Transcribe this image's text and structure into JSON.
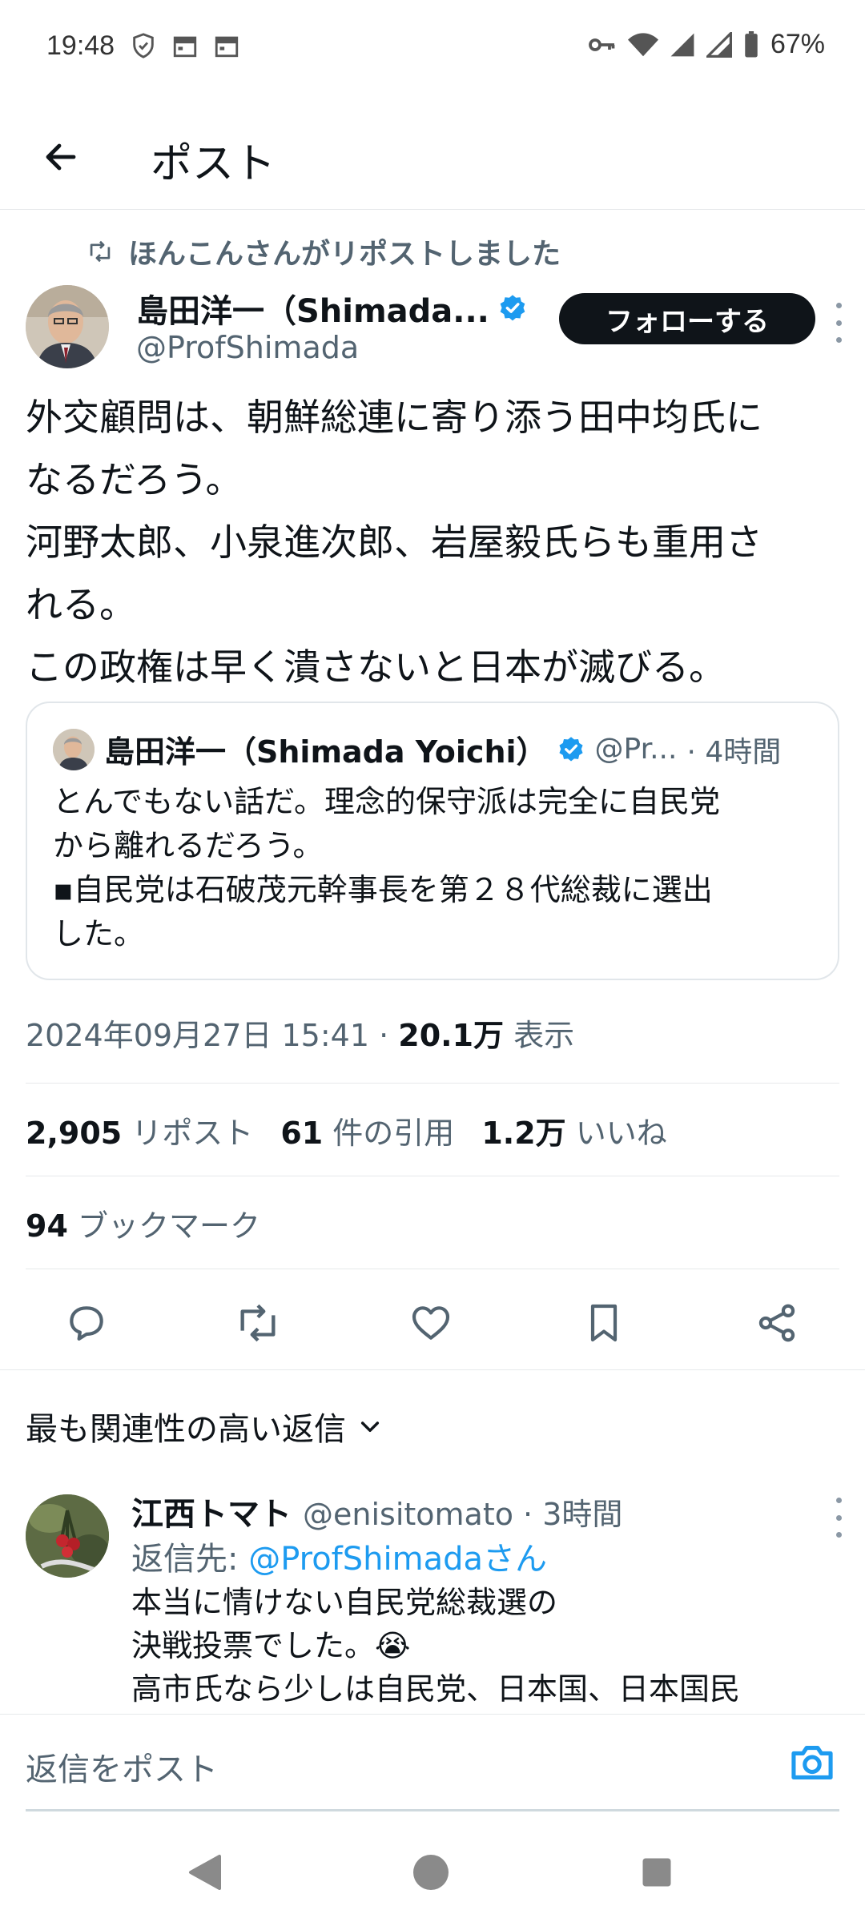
{
  "status_bar": {
    "time": "19:48",
    "battery": "67%",
    "icons_left": [
      "shield-icon",
      "calendar-icon",
      "calendar-icon"
    ],
    "icons_right": [
      "key-icon",
      "wifi-icon",
      "signal-icon",
      "signal-icon",
      "battery-icon"
    ]
  },
  "header": {
    "title": "ポスト",
    "back_icon": "arrow-left-icon"
  },
  "repost_notice": "ほんこんさんがリポストしました",
  "author": {
    "name": "島田洋一（Shimada...",
    "handle": "@ProfShimada",
    "verified": true,
    "follow_label": "フォローする"
  },
  "tweet": {
    "lines": [
      "外交顧問は、朝鮮総連に寄り添う田中均氏に",
      "なるだろう。",
      "河野太郎、小泉進次郎、岩屋毅氏らも重用さ",
      "れる。",
      "この政権は早く潰さないと日本が滅びる。"
    ]
  },
  "quote": {
    "name": "島田洋一（Shimada Yoichi）",
    "handle": "@Pr...",
    "time": "· 4時間",
    "lines": [
      "とんでもない話だ。理念的保守派は完全に自民党",
      "から離れるだろう。",
      "▪自民党は石破茂元幹事長を第２８代総裁に選出",
      "した。"
    ]
  },
  "meta": {
    "datetime": "2024年09月27日 15:41 · ",
    "views_value": "20.1万",
    "views_label": " 表示"
  },
  "stats": {
    "reposts_value": "2,905",
    "reposts_label": "リポスト",
    "quotes_value": "61",
    "quotes_label": "件の引用",
    "likes_value": "1.2万",
    "likes_label": "いいね",
    "bookmarks_value": "94",
    "bookmarks_label": "ブックマーク"
  },
  "actions": [
    "reply-icon",
    "repost-icon",
    "like-icon",
    "bookmark-icon",
    "share-icon"
  ],
  "sort": {
    "label": "最も関連性の高い返信"
  },
  "reply": {
    "name": "江西トマト",
    "handle": "@enisitomato · 3時間",
    "reply_to_prefix": "返信先: ",
    "reply_to_handle": "@ProfShimadaさん",
    "lines": [
      "本当に情けない自民党総裁選の",
      "決戦投票でした。😭",
      "高市氏なら少しは自民党、日本国、日本国民"
    ]
  },
  "compose": {
    "placeholder": "返信をポスト"
  },
  "colors": {
    "text": "#0f1419",
    "secondary": "#536471",
    "link": "#1d9bf0",
    "verified": "#1d9bf0"
  }
}
